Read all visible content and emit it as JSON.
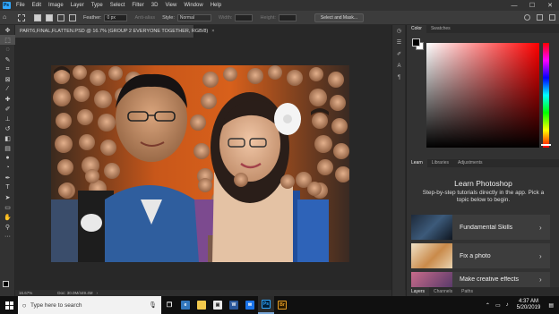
{
  "menubar": {
    "logo": "Ps",
    "items": [
      "File",
      "Edit",
      "Image",
      "Layer",
      "Type",
      "Select",
      "Filter",
      "3D",
      "View",
      "Window",
      "Help"
    ]
  },
  "window_controls": {
    "minimize": "—",
    "maximize": "☐",
    "close": "✕"
  },
  "options": {
    "feather_label": "Feather:",
    "feather_value": "0 px",
    "anti_alias_label": "Anti-alias",
    "style_label": "Style:",
    "style_value": "Normal",
    "width_label": "Width:",
    "height_label": "Height:",
    "select_mask_button": "Select and Mask..."
  },
  "document": {
    "tab_title": "PART6,FINAL,FLATTEN.PSD @ 16.7% (GROUP 2 EVERYONE TOGETHER, RGB/8)",
    "tab_close": "×",
    "zoom": "16.67%",
    "doc_info": "Doc: 30.0M/449.4M"
  },
  "right_panel": {
    "color_tabs": [
      "Color",
      "Swatches"
    ],
    "colors": {
      "hue": "#ff0000",
      "foreground": "#000000",
      "background": "#ffffff"
    },
    "learn_tabs": [
      "Learn",
      "Libraries",
      "Adjustments"
    ],
    "learn_title": "Learn Photoshop",
    "learn_desc": "Step-by-step tutorials directly in the app. Pick a topic below to begin.",
    "cards": [
      {
        "label": "Fundamental Skills"
      },
      {
        "label": "Fix a photo"
      },
      {
        "label": "Make creative effects"
      }
    ],
    "layers_tabs": [
      "Layers",
      "Channels",
      "Paths"
    ]
  },
  "taskbar": {
    "search_placeholder": "Type here to search",
    "apps": [
      {
        "name": "task-view",
        "glyph": "❐",
        "color": "#ffffff"
      },
      {
        "name": "edge",
        "glyph": "e",
        "color": "#3277bc"
      },
      {
        "name": "file-explorer",
        "glyph": "▬",
        "color": "#f2c94c"
      },
      {
        "name": "store",
        "glyph": "▣",
        "color": "#ffffff"
      },
      {
        "name": "word",
        "glyph": "W",
        "color": "#2b579a"
      },
      {
        "name": "mail",
        "glyph": "✉",
        "color": "#1a73e8"
      },
      {
        "name": "photoshop",
        "glyph": "Ps",
        "color": "#31a8ff"
      },
      {
        "name": "bridge",
        "glyph": "Br",
        "color": "#e79e25"
      }
    ],
    "time": "4:37 AM",
    "date": "5/20/2019"
  }
}
